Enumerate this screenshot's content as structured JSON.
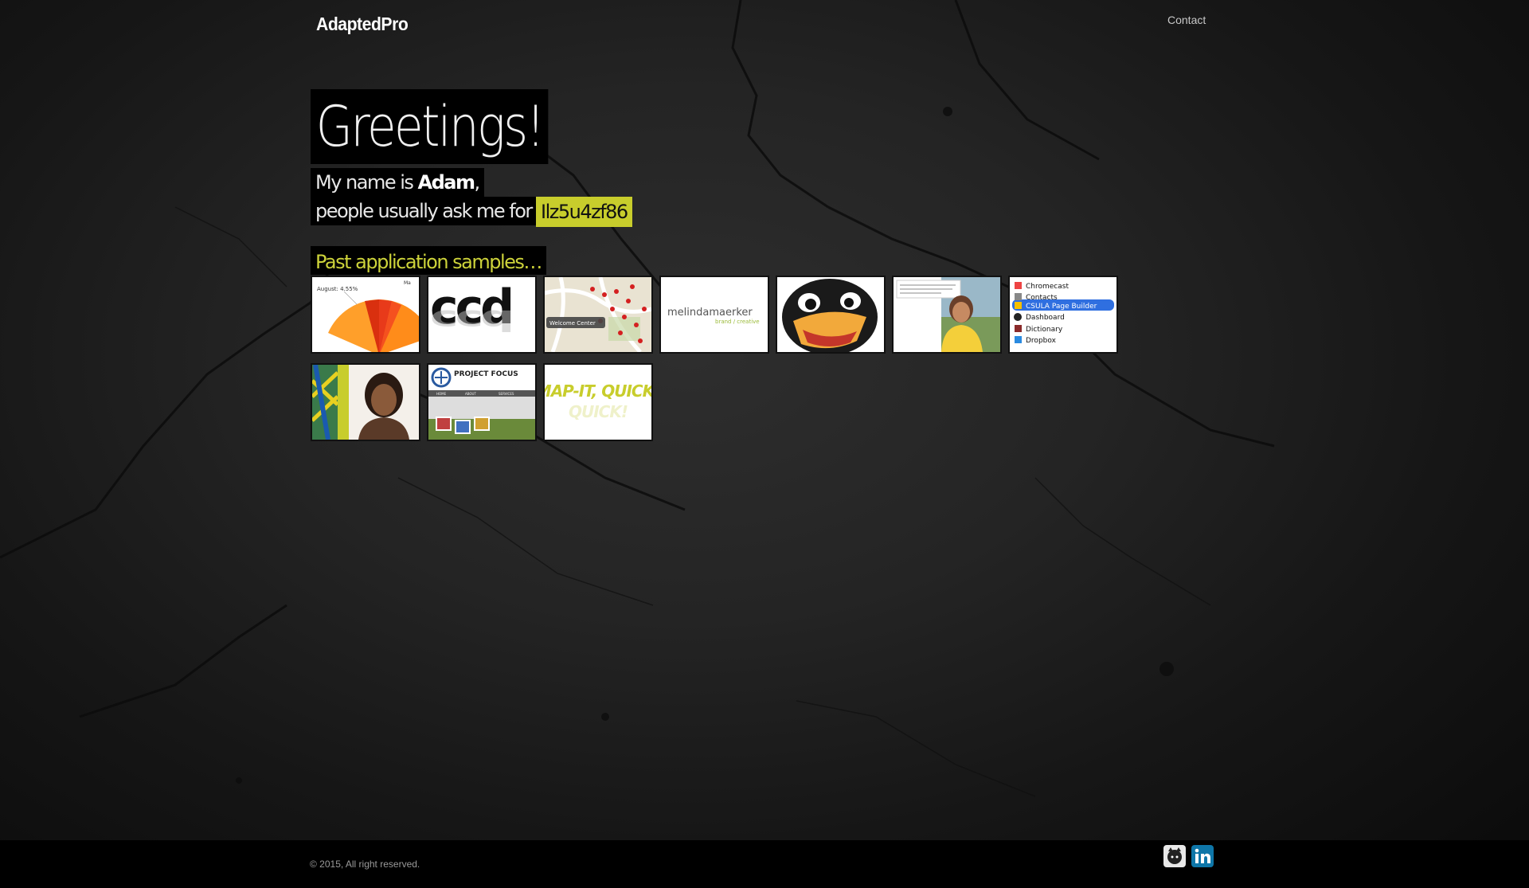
{
  "header": {
    "logo": "AdaptedPro",
    "nav": {
      "contact": "Contact"
    }
  },
  "hero": {
    "title": "Greetings!",
    "intro_prefix": "My name is ",
    "name": "Adam",
    "intro_suffix": ",",
    "ask_text": "people usually ask me for :",
    "code": "Ilz5u4zf86"
  },
  "samples": {
    "title": "Past application samples…",
    "items": [
      {
        "name": "pie-chart",
        "label": "August: 4.55%"
      },
      {
        "name": "ccd-logo",
        "label": "ccd"
      },
      {
        "name": "campus-map",
        "label": "Welcome Center"
      },
      {
        "name": "melinda-maerker",
        "label": "melindamaerker",
        "sub": "brand / creative"
      },
      {
        "name": "eagle-mascot",
        "label": ""
      },
      {
        "name": "student-testimonial",
        "label": ""
      },
      {
        "name": "app-menu",
        "items": [
          "Chromecast",
          "Contacts",
          "CSULA Page Builder",
          "Dashboard",
          "Dictionary",
          "Dropbox"
        ]
      },
      {
        "name": "student-portrait",
        "label": ""
      },
      {
        "name": "project-focus",
        "label": "PROJECT FOCUS",
        "nav": [
          "HOME",
          "ABOUT",
          "SERVICES"
        ]
      },
      {
        "name": "map-it-quick",
        "label": "MAP-IT, QUICK!"
      }
    ]
  },
  "footer": {
    "copyright": "© 2015, All right reserved.",
    "social": [
      "github-icon",
      "linkedin-icon"
    ]
  },
  "colors": {
    "accent": "#c8cd2c",
    "samples_title": "#cdd33a",
    "linkedin": "#0e76a8"
  }
}
